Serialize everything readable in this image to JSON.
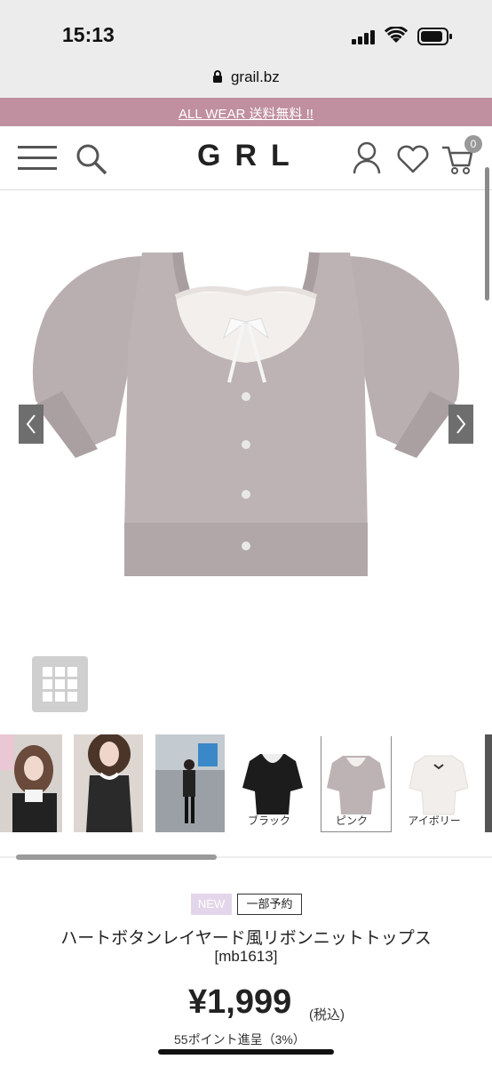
{
  "status": {
    "time": "15:13"
  },
  "browser": {
    "url": "grail.bz"
  },
  "promo": {
    "text": "ALL WEAR 送料無料 !!"
  },
  "header": {
    "logo": "GRL",
    "cart_count": "0"
  },
  "colors": {
    "promo_bg": "#c08fa0",
    "new_badge": "#e4d6ea",
    "knit": "#b8aeae"
  },
  "thumbnails": {
    "labels": [
      "ブラック",
      "ピンク",
      "アイボリー"
    ]
  },
  "product": {
    "badge_new": "NEW",
    "badge_preorder": "一部予約",
    "title": "ハートボタンレイヤード風リボンニットトップス",
    "code": "[mb1613]",
    "price": "¥1,999",
    "tax": "(税込)",
    "points": "55ポイント進呈（3%）"
  }
}
